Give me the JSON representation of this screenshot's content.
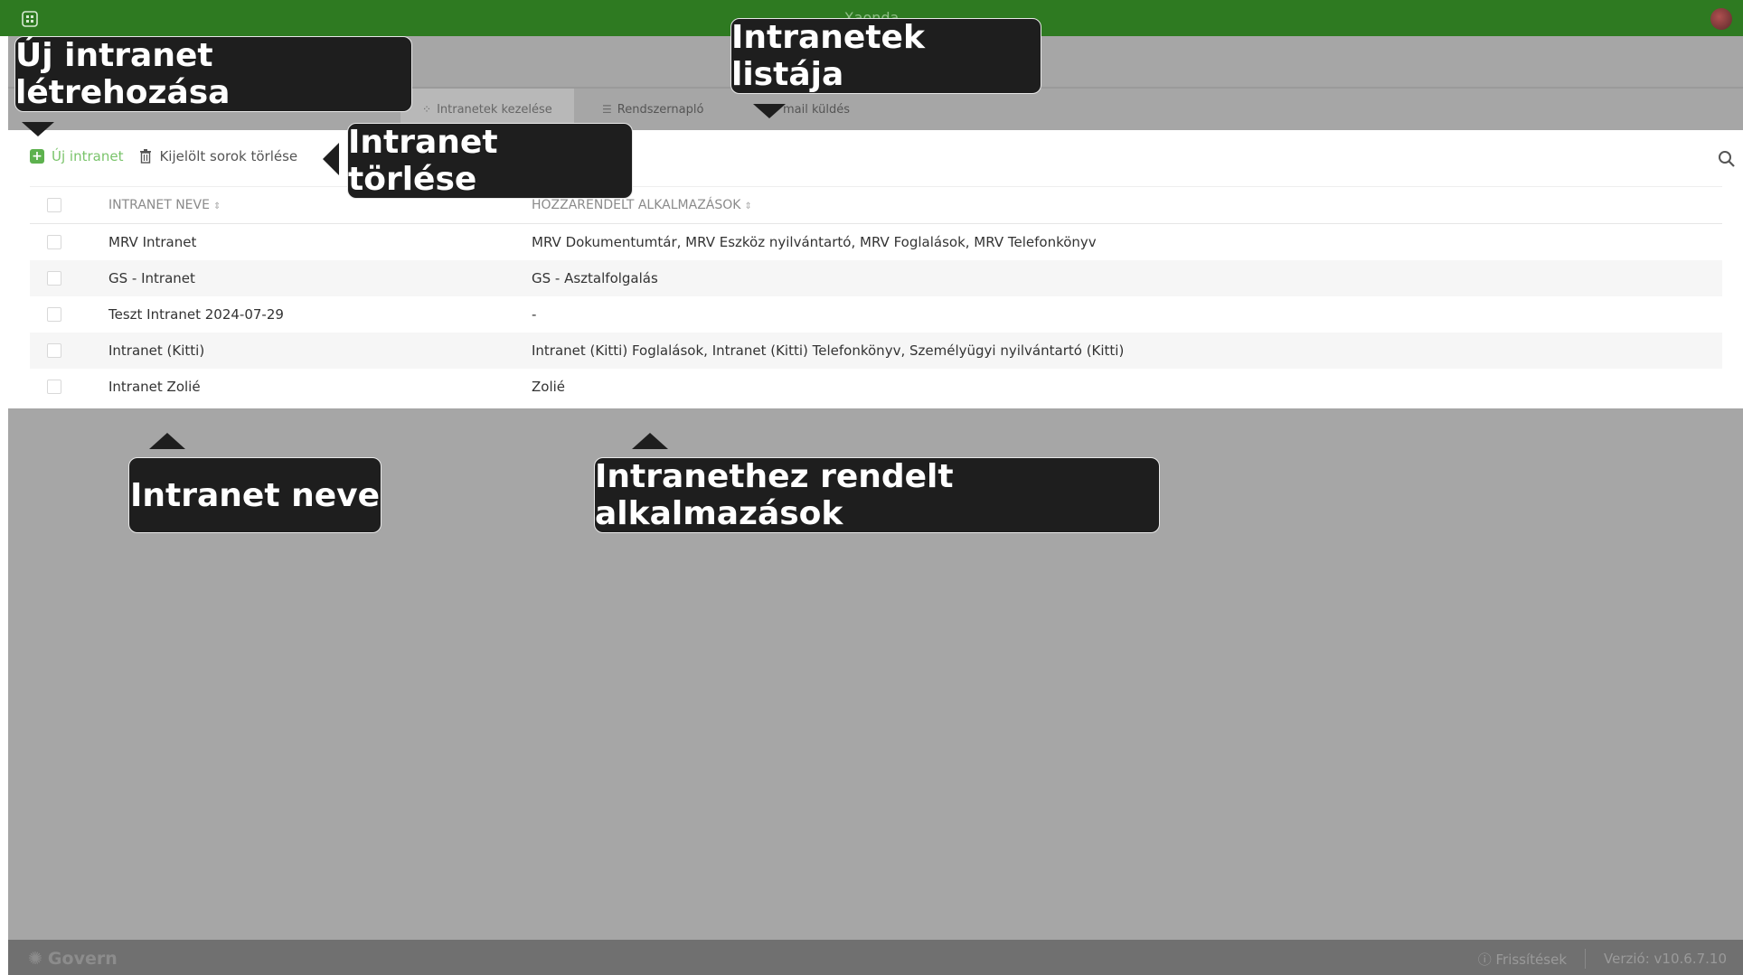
{
  "app": {
    "title": "Xaonda"
  },
  "tabs": [
    {
      "label": "Intranetek kezelése",
      "icon": "grid-icon",
      "active": true
    },
    {
      "label": "Rendszernapló",
      "icon": "list-icon"
    },
    {
      "label": "mail küldés",
      "icon": "mail-icon"
    }
  ],
  "toolbar": {
    "new_label": "Új intranet",
    "delete_label": "Kijelölt sorok törlése"
  },
  "table": {
    "columns": [
      "INTRANET NEVE",
      "HOZZÁRENDELT ALKALMAZÁSOK"
    ],
    "rows": [
      {
        "name": "MRV Intranet",
        "apps": "MRV Dokumentumtár, MRV Eszköz nyilvántartó, MRV Foglalások, MRV Telefonkönyv"
      },
      {
        "name": "GS - Intranet",
        "apps": "GS - Asztalfolgalás"
      },
      {
        "name": "Teszt Intranet 2024-07-29",
        "apps": "-"
      },
      {
        "name": "Intranet (Kitti)",
        "apps": "Intranet (Kitti) Foglalások, Intranet (Kitti) Telefonkönyv, Személyügyi nyilvántartó (Kitti)"
      },
      {
        "name": "Intranet Zolié",
        "apps": "Zolié"
      }
    ]
  },
  "tooltips": {
    "new": "Új intranet létrehozása",
    "list": "Intranetek listája",
    "delete": "Intranet törlése",
    "name": "Intranet neve",
    "apps": "Intranethez rendelt alkalmazások"
  },
  "footer": {
    "logo": "Govern",
    "updates": "Frissítések",
    "version": "Verzió: v10.6.7.10"
  },
  "colors": {
    "topbar": "#2e7a21",
    "accent": "#5db14e",
    "overlay": "#a6a6a6",
    "tooltip": "#1e1e1e"
  }
}
